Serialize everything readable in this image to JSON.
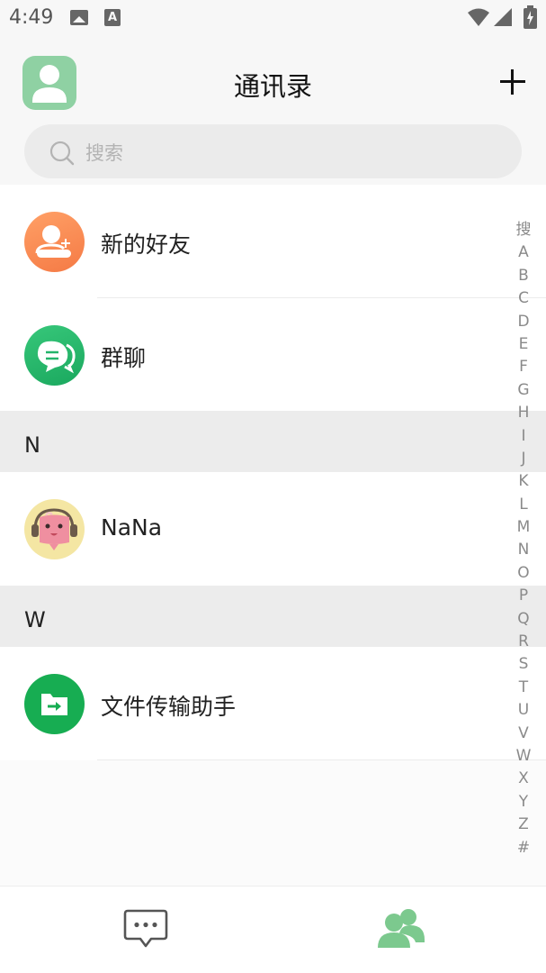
{
  "status_bar": {
    "time": "4:49",
    "icons": [
      "image-icon",
      "text-a-icon",
      "wifi-icon",
      "cellular-icon",
      "battery-charging-icon"
    ]
  },
  "header": {
    "title": "通讯录",
    "avatar_icon": "user-avatar-icon",
    "add_icon": "plus-icon"
  },
  "search": {
    "placeholder": "搜索",
    "icon": "search-icon"
  },
  "list": {
    "new_friends": {
      "label": "新的好友",
      "icon": "add-friend-icon"
    },
    "group_chat": {
      "label": "群聊",
      "icon": "group-chat-icon"
    },
    "sections": [
      {
        "letter": "N",
        "contacts": [
          {
            "name": "NaNa",
            "avatar": "cartoon-avatar"
          }
        ]
      },
      {
        "letter": "W",
        "contacts": [
          {
            "name": "文件传输助手",
            "avatar": "file-transfer-icon"
          }
        ]
      }
    ]
  },
  "index_bar": [
    "搜",
    "A",
    "B",
    "C",
    "D",
    "E",
    "F",
    "G",
    "H",
    "I",
    "J",
    "K",
    "L",
    "M",
    "N",
    "O",
    "P",
    "Q",
    "R",
    "S",
    "T",
    "U",
    "V",
    "W",
    "X",
    "Y",
    "Z",
    "#"
  ],
  "bottom_nav": {
    "items": [
      {
        "icon": "chat-bubble-icon",
        "active": false
      },
      {
        "icon": "contacts-icon",
        "active": true
      }
    ]
  },
  "colors": {
    "accent": "#7cc98e",
    "new_friend_orange": "#f98a50",
    "group_green": "#23b46a",
    "file_green": "#17ad52",
    "index_gray": "#8a8a8a"
  }
}
